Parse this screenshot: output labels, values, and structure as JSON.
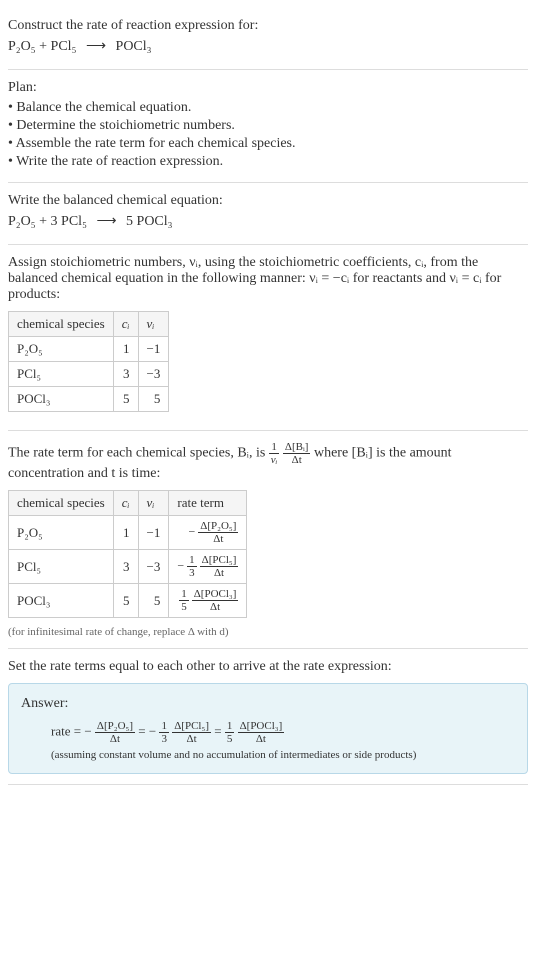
{
  "header": {
    "title": "Construct the rate of reaction expression for:",
    "equation_lhs": "P₂O₅ + PCl₅",
    "arrow": "⟶",
    "equation_rhs": "POCl₃"
  },
  "plan": {
    "title": "Plan:",
    "items": [
      "• Balance the chemical equation.",
      "• Determine the stoichiometric numbers.",
      "• Assemble the rate term for each chemical species.",
      "• Write the rate of reaction expression."
    ]
  },
  "balanced": {
    "title": "Write the balanced chemical equation:",
    "equation_lhs": "P₂O₅ + 3 PCl₅",
    "arrow": "⟶",
    "equation_rhs": "5 POCl₃"
  },
  "stoich": {
    "title": "Assign stoichiometric numbers, νᵢ, using the stoichiometric coefficients, cᵢ, from the balanced chemical equation in the following manner: νᵢ = −cᵢ for reactants and νᵢ = cᵢ for products:",
    "headers": {
      "species": "chemical species",
      "ci": "cᵢ",
      "vi": "νᵢ"
    },
    "rows": [
      {
        "species": "P₂O₅",
        "ci": "1",
        "vi": "−1"
      },
      {
        "species": "PCl₅",
        "ci": "3",
        "vi": "−3"
      },
      {
        "species": "POCl₃",
        "ci": "5",
        "vi": "5"
      }
    ]
  },
  "rateterm": {
    "title_p1": "The rate term for each chemical species, Bᵢ, is ",
    "title_frac_num": "1",
    "title_frac_den": "νᵢ",
    "title_frac2_num": "Δ[Bᵢ]",
    "title_frac2_den": "Δt",
    "title_p2": " where [Bᵢ] is the amount concentration and t is time:",
    "headers": {
      "species": "chemical species",
      "ci": "cᵢ",
      "vi": "νᵢ",
      "rate": "rate term"
    },
    "rows": [
      {
        "species": "P₂O₅",
        "ci": "1",
        "vi": "−1",
        "rate_prefix": "−",
        "rate_coef_num": "",
        "rate_coef_den": "",
        "rate_num": "Δ[P₂O₅]",
        "rate_den": "Δt"
      },
      {
        "species": "PCl₅",
        "ci": "3",
        "vi": "−3",
        "rate_prefix": "−",
        "rate_coef_num": "1",
        "rate_coef_den": "3",
        "rate_num": "Δ[PCl₅]",
        "rate_den": "Δt"
      },
      {
        "species": "POCl₃",
        "ci": "5",
        "vi": "5",
        "rate_prefix": "",
        "rate_coef_num": "1",
        "rate_coef_den": "5",
        "rate_num": "Δ[POCl₃]",
        "rate_den": "Δt"
      }
    ],
    "footnote": "(for infinitesimal rate of change, replace Δ with d)"
  },
  "final": {
    "title": "Set the rate terms equal to each other to arrive at the rate expression:"
  },
  "answer": {
    "label": "Answer:",
    "rate_label": "rate = ",
    "t1_prefix": "−",
    "t1_num": "Δ[P₂O₅]",
    "t1_den": "Δt",
    "eq1": " = ",
    "t2_prefix": "−",
    "t2_coef_num": "1",
    "t2_coef_den": "3",
    "t2_num": "Δ[PCl₅]",
    "t2_den": "Δt",
    "eq2": " = ",
    "t3_coef_num": "1",
    "t3_coef_den": "5",
    "t3_num": "Δ[POCl₃]",
    "t3_den": "Δt",
    "footnote": "(assuming constant volume and no accumulation of intermediates or side products)"
  }
}
